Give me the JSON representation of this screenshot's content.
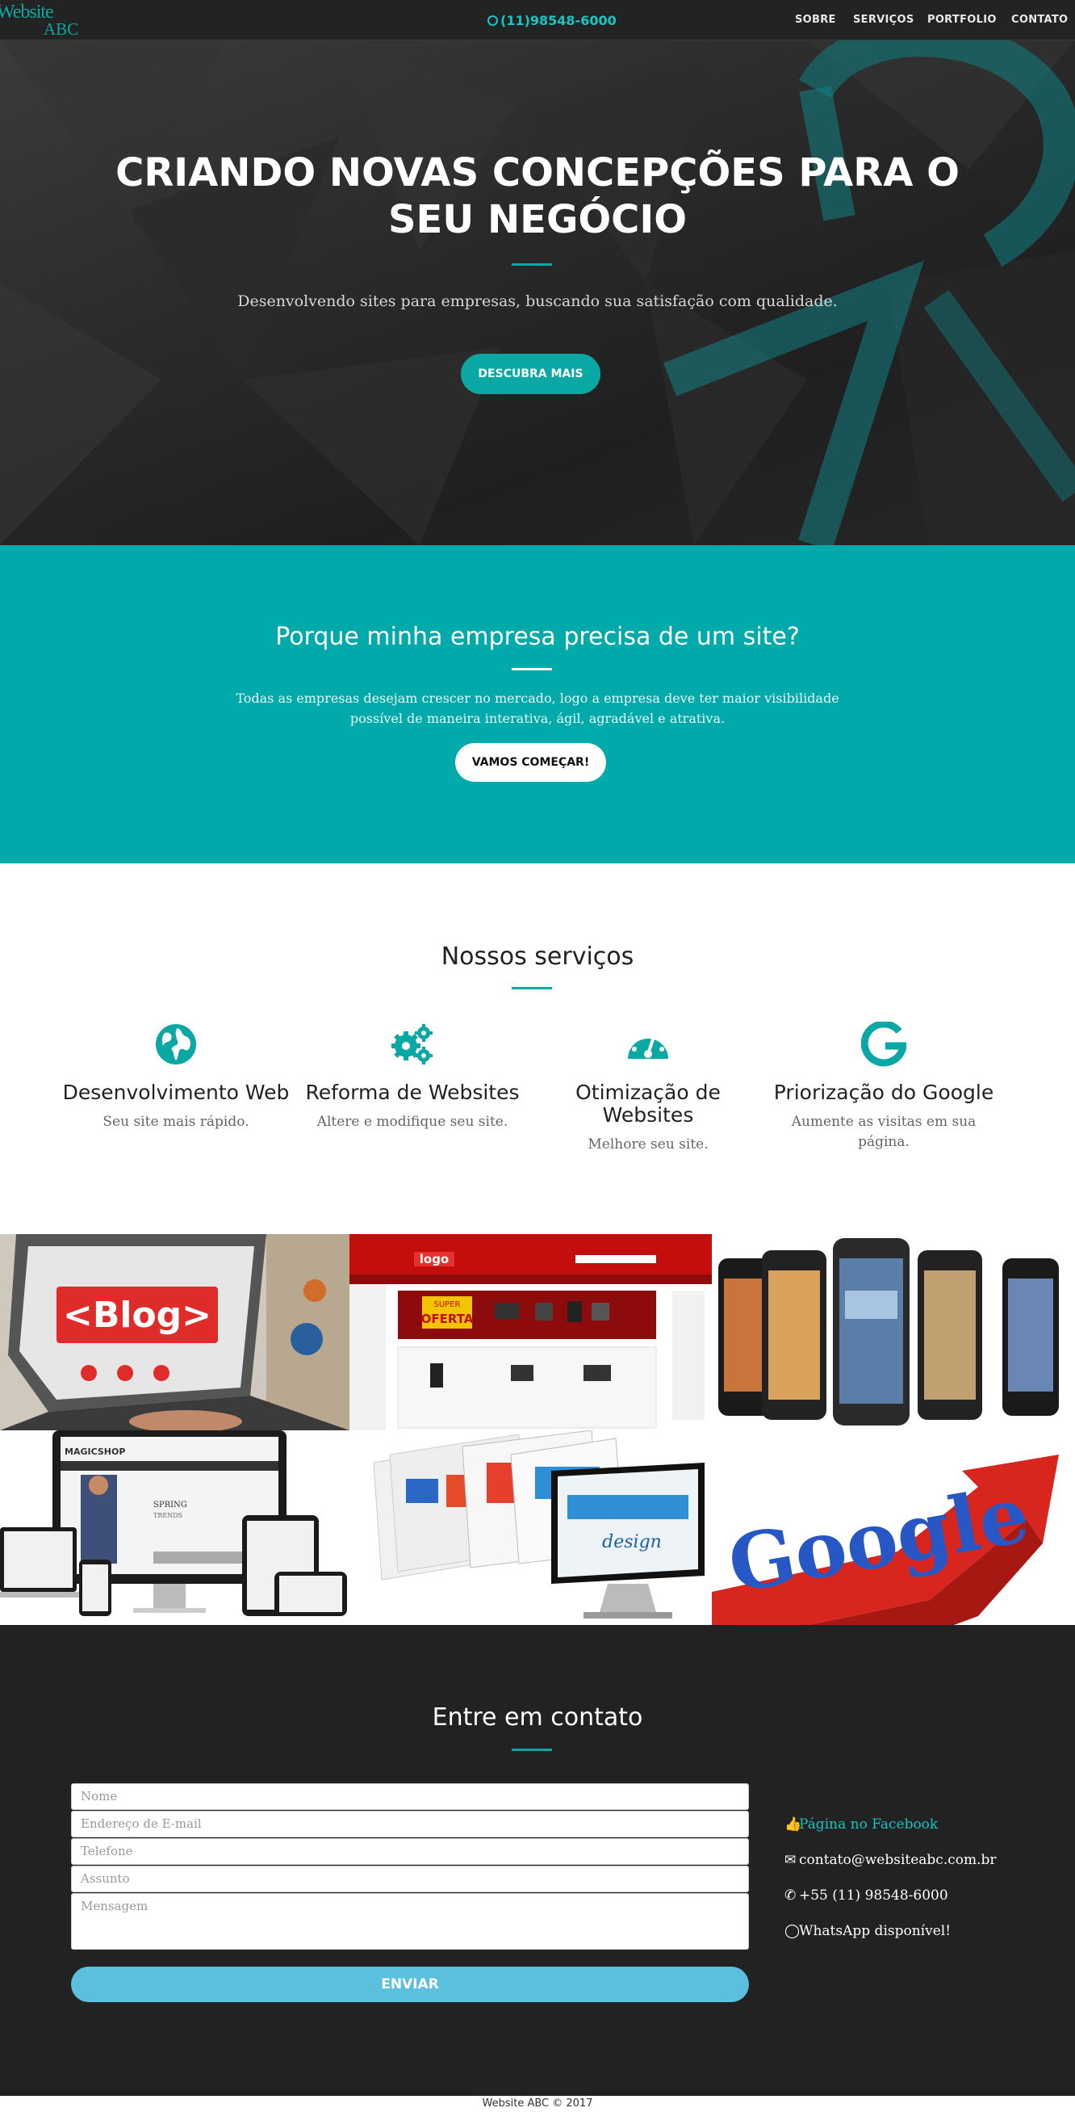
{
  "nav": {
    "logo_line1": "Website",
    "logo_line2": "ABC",
    "phone": "(11)98548-6000",
    "menu": [
      "SOBRE",
      "SERVIÇOS",
      "PORTFOLIO",
      "CONTATO"
    ],
    "accent": "#0aa8a4"
  },
  "hero": {
    "title_line1": "CRIANDO NOVAS CONCEPÇÕES PARA O",
    "title_line2": "SEU NEGÓCIO",
    "subtitle": "Desenvolvendo sites para empresas, buscando sua satisfação com qualidade.",
    "button": "DESCUBRA MAIS"
  },
  "why": {
    "title": "Porque minha empresa precisa de um site?",
    "text_line1": "Todas as empresas desejam crescer no mercado, logo a empresa deve ter maior visibilidade",
    "text_line2": "possível de maneira interativa, ágil, agradável e atrativa.",
    "button": "VAMOS COMEÇAR!",
    "background": "#00aaaa"
  },
  "services": {
    "title": "Nossos serviços",
    "items": [
      {
        "icon": "globe-icon",
        "name": "Desenvolvimento Web",
        "desc_line1": "Seu site mais rápido.",
        "desc_line2": ""
      },
      {
        "icon": "gears-icon",
        "name": "Reforma de Websites",
        "desc_line1": "Altere e modifique seu site.",
        "desc_line2": ""
      },
      {
        "icon": "dashboard-icon",
        "name_line1": "Otimização de",
        "name_line2": "Websites",
        "desc_line1": "Melhore seu site.",
        "desc_line2": ""
      },
      {
        "icon": "google-icon",
        "name": "Priorização do Google",
        "desc_line1": "Aumente as visitas em sua",
        "desc_line2": "página."
      }
    ]
  },
  "portfolio": {
    "blog_text": "<Blog>",
    "shop_logo": "logo",
    "shop_banner_1": "SUPER",
    "shop_banner_2": "OFERTA",
    "magic_shop": "MAGICSHOP",
    "magic_spring": "SPRING",
    "magic_trends": "TRENDS",
    "design_text": "design",
    "google_word": "Google"
  },
  "contact": {
    "title": "Entre em contato",
    "fields": {
      "name_placeholder": "Nome",
      "email_placeholder": "Endereço de E-mail",
      "phone_placeholder": "Telefone",
      "subject_placeholder": "Assunto",
      "message_placeholder": "Mensagem"
    },
    "send_button": "ENVIAR",
    "facebook": "Página no Facebook",
    "email": "contato@websiteabc.com.br",
    "phone": "+55 (11) 98548-6000",
    "whatsapp": "WhatsApp disponível!"
  },
  "footer": {
    "text": "Website ABC © 2017"
  }
}
